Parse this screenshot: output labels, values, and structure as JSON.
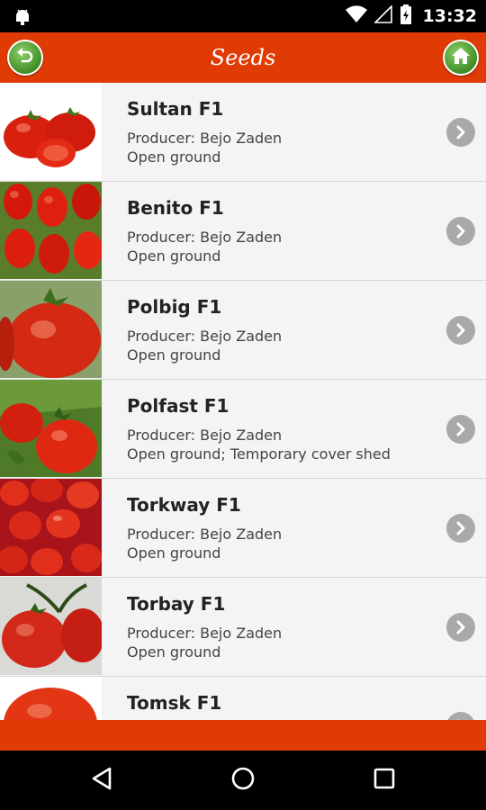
{
  "status_bar": {
    "time": "13:32",
    "icons": [
      "android-icon",
      "wifi-icon",
      "signal-icon",
      "battery-icon"
    ]
  },
  "header": {
    "title": "Seeds",
    "back_icon": "back-arrow-icon",
    "home_icon": "home-icon"
  },
  "seeds": [
    {
      "name": "Sultan F1",
      "producer": "Producer: Bejo Zaden",
      "growing": "Open ground"
    },
    {
      "name": "Benito F1",
      "producer": "Producer: Bejo Zaden",
      "growing": "Open ground"
    },
    {
      "name": "Polbig F1",
      "producer": "Producer: Bejo Zaden",
      "growing": "Open ground"
    },
    {
      "name": "Polfast F1",
      "producer": "Producer: Bejo Zaden",
      "growing": "Open ground; Temporary cover shed"
    },
    {
      "name": "Torkway F1",
      "producer": "Producer: Bejo Zaden",
      "growing": "Open ground"
    },
    {
      "name": "Torbay F1",
      "producer": "Producer: Bejo Zaden",
      "growing": "Open ground"
    },
    {
      "name": "Tomsk F1",
      "producer": "",
      "growing": ""
    }
  ],
  "nav": {
    "icons": [
      "back-triangle-icon",
      "home-circle-icon",
      "recents-square-icon"
    ]
  },
  "colors": {
    "accent": "#e03a05",
    "button_green": "#4f9e2e",
    "list_bg": "#f4f4f4",
    "chevron_gray": "#a9a9a9"
  }
}
